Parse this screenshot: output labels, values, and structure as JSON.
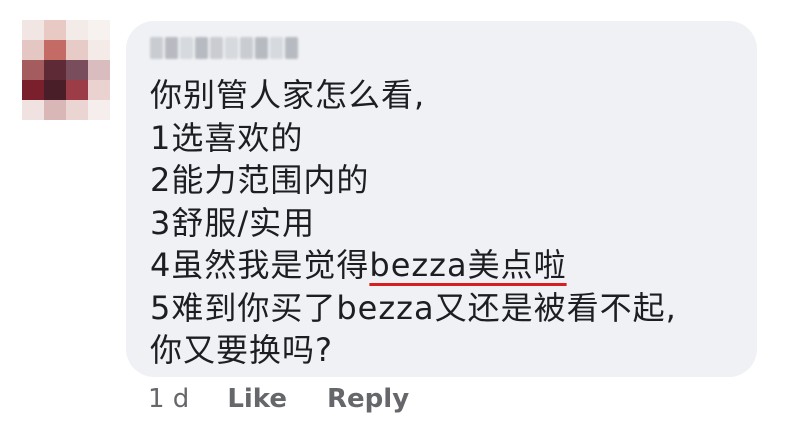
{
  "comment": {
    "lines": [
      "你别管人家怎么看,",
      "1选喜欢的",
      "2能力范围内的",
      "3舒服/实用",
      "5难到你买了bezza又还是被看不起,",
      "你又要换吗?"
    ],
    "line4_prefix": "4虽然我是觉得",
    "line4_underlined": "bezza美点啦"
  },
  "actions": {
    "time": "1 d",
    "like": "Like",
    "reply": "Reply"
  },
  "colors": {
    "bubble": "#eff1f4",
    "text": "#1c1e21",
    "meta": "#65676b",
    "underline": "#d81f1f"
  }
}
